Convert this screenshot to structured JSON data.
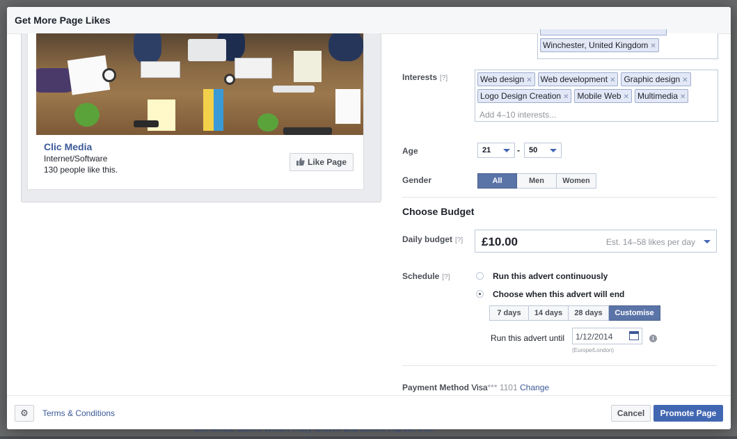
{
  "dialog": {
    "title": "Get More Page Likes"
  },
  "preview": {
    "page_name": "Clic Media",
    "category": "Internet/Software",
    "likes_text": "130 people like this.",
    "like_button": "Like Page"
  },
  "targeting": {
    "location_tag": "Winchester, United Kingdom",
    "interests_label": "Interests",
    "help": "[?]",
    "interests": [
      "Web design",
      "Web development",
      "Graphic design",
      "Logo Design Creation",
      "Mobile Web",
      "Multimedia"
    ],
    "interests_placeholder": "Add 4–10 interests...",
    "age_label": "Age",
    "age_min": "21",
    "age_sep": "-",
    "age_max": "50",
    "gender_label": "Gender",
    "gender_options": [
      "All",
      "Men",
      "Women"
    ],
    "gender_selected": "All"
  },
  "budget": {
    "heading": "Choose Budget",
    "daily_label": "Daily budget",
    "amount": "£10.00",
    "estimate": "Est. 14–58 likes per day",
    "schedule_label": "Schedule",
    "option_continuous": "Run this advert continuously",
    "option_end": "Choose when this advert will end",
    "durations": [
      "7 days",
      "14 days",
      "28 days",
      "Customise"
    ],
    "duration_selected": "Customise",
    "until_label": "Run this advert until",
    "end_date": "1/12/2014",
    "timezone": "(Europe/London)",
    "payment_label": "Payment Method",
    "payment_card": "Visa",
    "payment_digits": "*** 1101",
    "payment_change": "Change"
  },
  "footer": {
    "terms": "Terms & Conditions",
    "cancel": "Cancel",
    "promote": "Promote Page"
  },
  "background": {
    "bottom_text": "Clic Media, James Welsh, Tracy Craven and Justine Hip like this."
  },
  "colors": {
    "accent": "#4267b2",
    "link": "#3b5998",
    "selected": "#5b74a8"
  }
}
